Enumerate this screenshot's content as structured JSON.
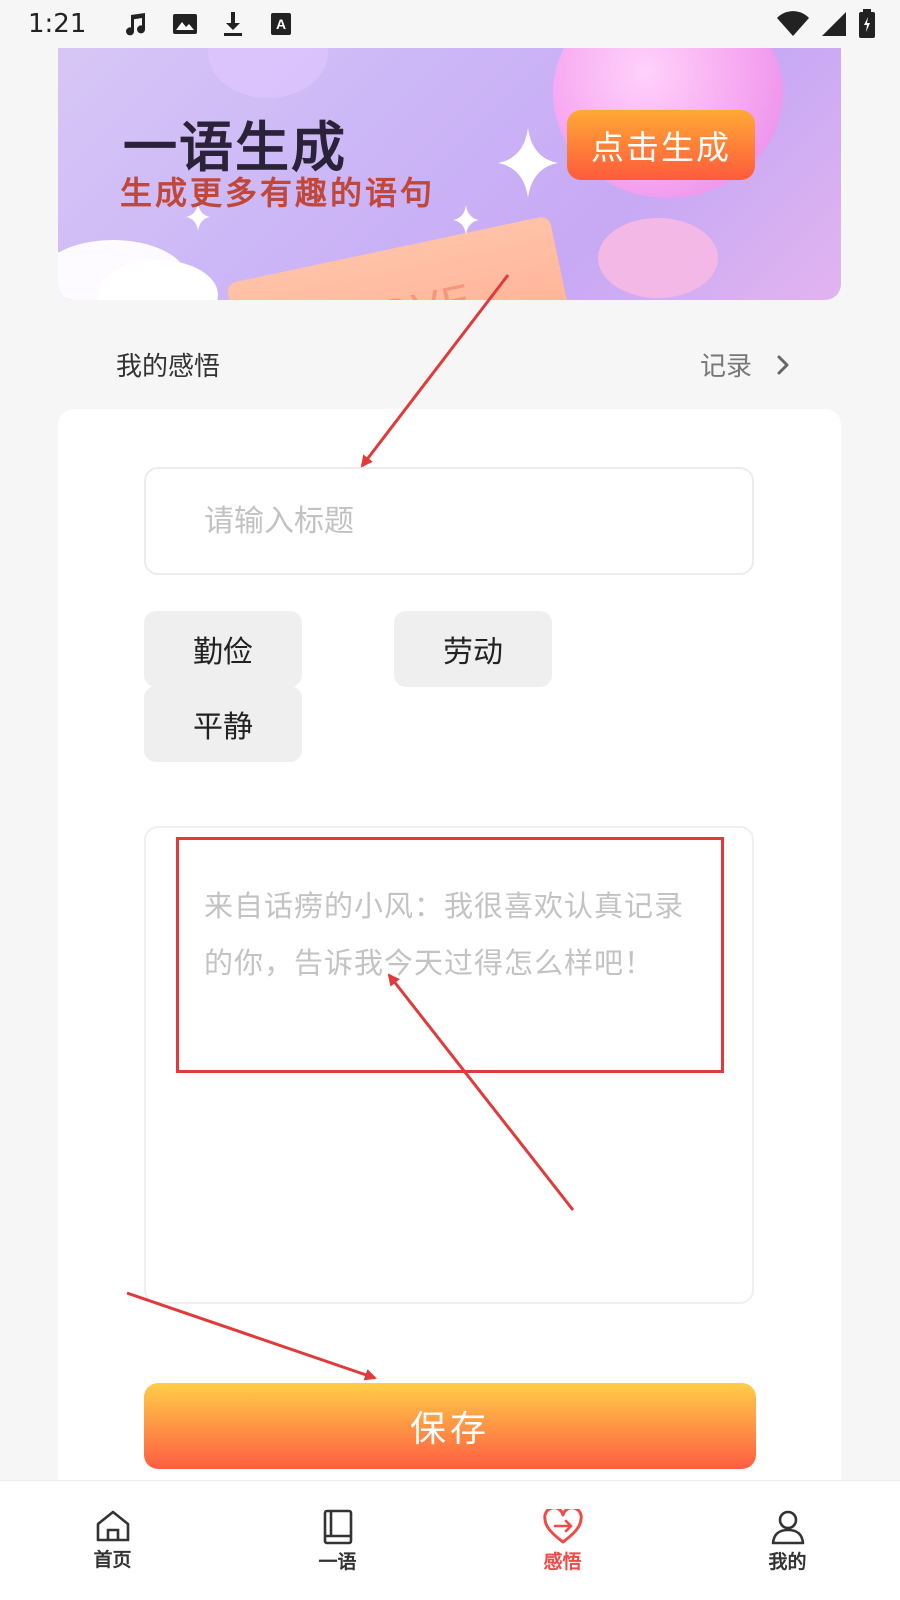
{
  "status_bar": {
    "time": "1:21",
    "icons": [
      "music-icon",
      "image-icon",
      "download-icon",
      "a-icon",
      "wifi-icon",
      "signal-icon",
      "battery-icon"
    ]
  },
  "banner": {
    "title": "一语生成",
    "subtitle": "生成更多有趣的语句",
    "decoration_text": "LOVE",
    "generate_label": "点击生成"
  },
  "section": {
    "title": "我的感悟",
    "record_label": "记录"
  },
  "form": {
    "title_placeholder": "请输入标题",
    "tags": [
      "勤俭",
      "劳动",
      "平静"
    ],
    "content_placeholder": "来自话痨的小风：我很喜欢认真记录的你，告诉我今天过得怎么样吧！",
    "save_label": "保存"
  },
  "bottom_nav": {
    "items": [
      {
        "label": "首页",
        "icon": "home-icon",
        "active": false
      },
      {
        "label": "一语",
        "icon": "book-icon",
        "active": false
      },
      {
        "label": "感悟",
        "icon": "heart-icon",
        "active": true
      },
      {
        "label": "我的",
        "icon": "user-icon",
        "active": false
      }
    ]
  },
  "colors": {
    "accent": "#f04a4a",
    "button_gradient_top": "#ffce48",
    "button_gradient_bottom": "#ff5d42",
    "annotation_red": "#e03a3a"
  }
}
